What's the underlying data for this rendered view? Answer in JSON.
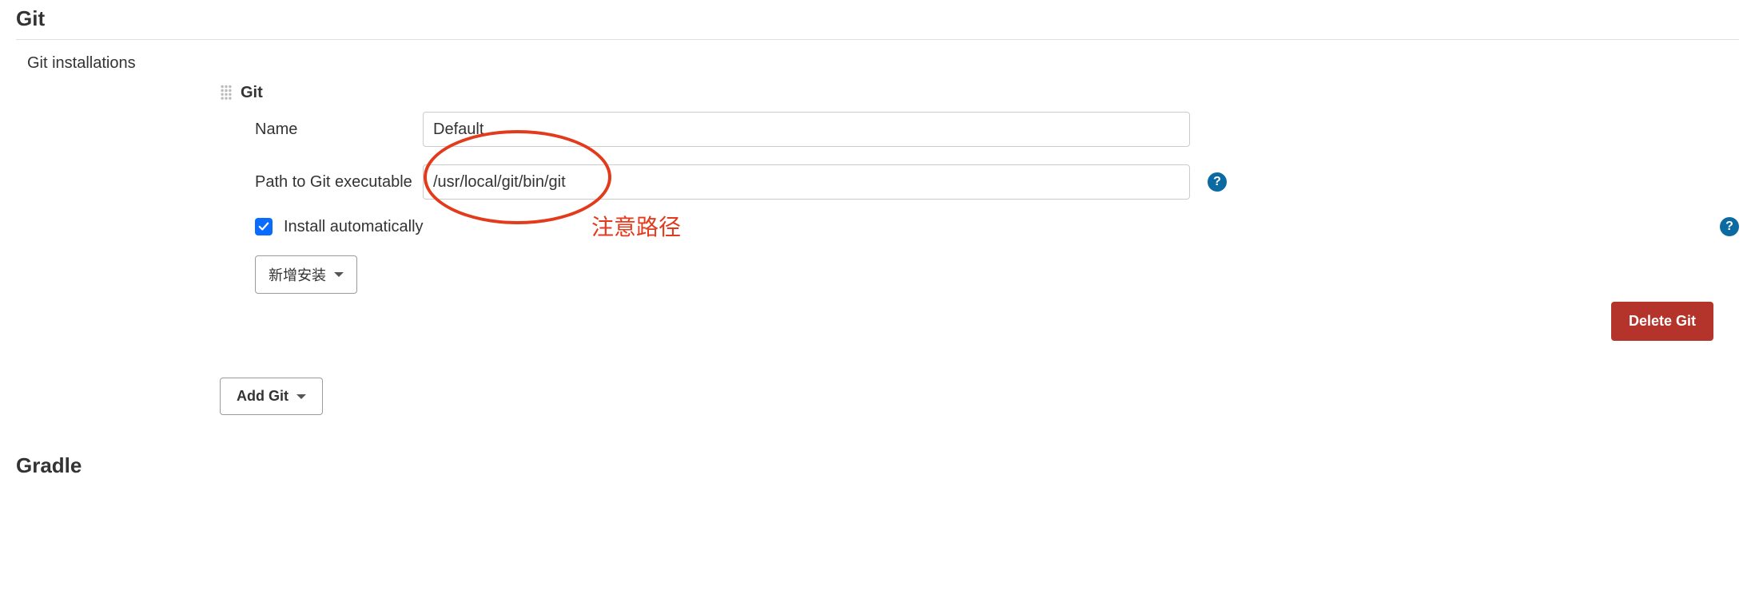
{
  "sections": {
    "git_header": "Git",
    "gradle_header": "Gradle"
  },
  "installations_label": "Git installations",
  "tool": {
    "title": "Git",
    "name_label": "Name",
    "name_value": "Default",
    "path_label": "Path to Git executable",
    "path_value": "/usr/local/git/bin/git",
    "install_auto_label": "Install automatically",
    "install_auto_checked": true,
    "add_installer_label": "新增安装",
    "delete_label": "Delete Git"
  },
  "add_git_label": "Add Git",
  "annotation": {
    "text": "注意路径"
  }
}
